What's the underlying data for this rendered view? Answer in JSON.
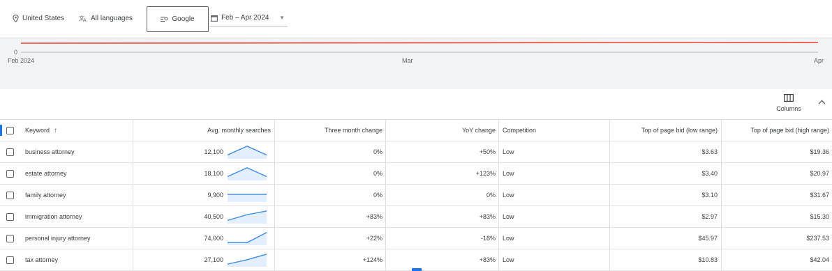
{
  "filters": {
    "location": "United States",
    "language": "All languages",
    "network": "Google",
    "date_range": "Feb – Apr 2024"
  },
  "chart": {
    "y_tick": "0",
    "x_ticks": [
      "Feb 2024",
      "Mar",
      "Apr"
    ],
    "line_color": "#ea4335"
  },
  "columns_button": "Columns",
  "table": {
    "headers": {
      "keyword": "Keyword",
      "avg": "Avg. monthly searches",
      "three_month": "Three month change",
      "yoy": "YoY change",
      "competition": "Competition",
      "low_bid": "Top of page bid (low range)",
      "high_bid": "Top of page bid (high range)"
    },
    "rows": [
      {
        "keyword": "business attorney",
        "avg": "12,100",
        "trend": [
          0.2,
          0.9,
          0.2
        ],
        "three_month": "0%",
        "yoy": "+50%",
        "competition": "Low",
        "low_bid": "$3.63",
        "high_bid": "$19.36"
      },
      {
        "keyword": "estate attorney",
        "avg": "18,100",
        "trend": [
          0.2,
          0.9,
          0.2
        ],
        "three_month": "0%",
        "yoy": "+123%",
        "competition": "Low",
        "low_bid": "$3.40",
        "high_bid": "$20.97"
      },
      {
        "keyword": "family attorney",
        "avg": "9,900",
        "trend": [
          0.5,
          0.5,
          0.5
        ],
        "three_month": "0%",
        "yoy": "0%",
        "competition": "Low",
        "low_bid": "$3.10",
        "high_bid": "$31.67"
      },
      {
        "keyword": "immigration attorney",
        "avg": "40,500",
        "trend": [
          0.15,
          0.6,
          0.9
        ],
        "three_month": "+83%",
        "yoy": "+83%",
        "competition": "Low",
        "low_bid": "$2.97",
        "high_bid": "$15.30"
      },
      {
        "keyword": "personal injury attorney",
        "avg": "74,000",
        "trend": [
          0.1,
          0.1,
          0.9
        ],
        "three_month": "+22%",
        "yoy": "-18%",
        "competition": "Low",
        "low_bid": "$45.97",
        "high_bid": "$237.53"
      },
      {
        "keyword": "tax attorney",
        "avg": "27,100",
        "trend": [
          0.1,
          0.45,
          0.9
        ],
        "three_month": "+124%",
        "yoy": "+83%",
        "competition": "Low",
        "low_bid": "$10.83",
        "high_bid": "$42.04"
      }
    ]
  },
  "colors": {
    "accent": "#1a73e8",
    "spark_line": "#4a90e2",
    "spark_fill": "#e3efff"
  }
}
